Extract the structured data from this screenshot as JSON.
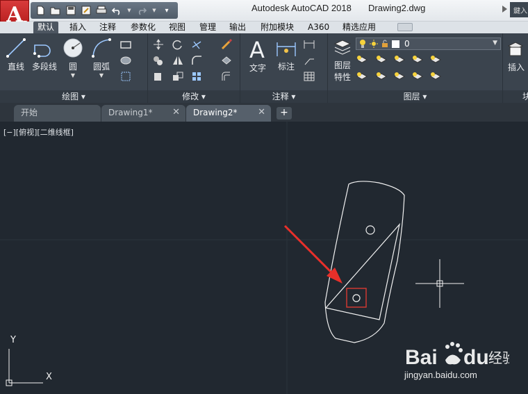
{
  "title_bar": {
    "app_name": "Autodesk AutoCAD 2018",
    "file_name": "Drawing2.dwg",
    "search_hint": "鍵入"
  },
  "app_button": {
    "letter": "A",
    "icon": "autocad-logo-icon"
  },
  "quick_access": [
    "new-icon",
    "open-icon",
    "save-icon",
    "saveas-icon",
    "print-icon",
    "undo-icon",
    "redo-icon",
    "more-icon"
  ],
  "ribbon_tabs": [
    {
      "label": "默认",
      "active": true
    },
    {
      "label": "插入"
    },
    {
      "label": "注释"
    },
    {
      "label": "参数化"
    },
    {
      "label": "视图"
    },
    {
      "label": "管理"
    },
    {
      "label": "输出"
    },
    {
      "label": "附加模块"
    },
    {
      "label": "A360"
    },
    {
      "label": "精选应用"
    }
  ],
  "ribbon": {
    "draw_panel": {
      "label": "绘图 ▾",
      "line": "直线",
      "polyline": "多段线",
      "circle": "圆",
      "arc": "圆弧"
    },
    "modify_panel": {
      "label": "修改 ▾"
    },
    "annotation_panel": {
      "label": "注释 ▾",
      "text": "文字",
      "dimension": "标注"
    },
    "layers_panel": {
      "label": "图层 ▾",
      "layer_properties": "图层\n特性",
      "layer_properties_l1": "图层",
      "layer_properties_l2": "特性",
      "current_layer": "0"
    },
    "block_panel": {
      "insert": "插入",
      "label": "块"
    }
  },
  "doc_tabs": [
    {
      "label": "开始"
    },
    {
      "label": "Drawing1*",
      "close": "✕"
    },
    {
      "label": "Drawing2*",
      "close": "✕",
      "active": true
    }
  ],
  "plus_tab": "+",
  "canvas": {
    "viewport_label": "[−][俯视][二维线框]",
    "ucs_x": "X",
    "ucs_y": "Y"
  },
  "watermark": {
    "brand": "Bai du 经验",
    "url": "jingyan.baidu.com"
  },
  "colors": {
    "canvas_bg": "#212830",
    "ribbon_bg": "#3b444e",
    "highlight_arrow": "#e8302a",
    "selection_box": "#d93a32"
  }
}
